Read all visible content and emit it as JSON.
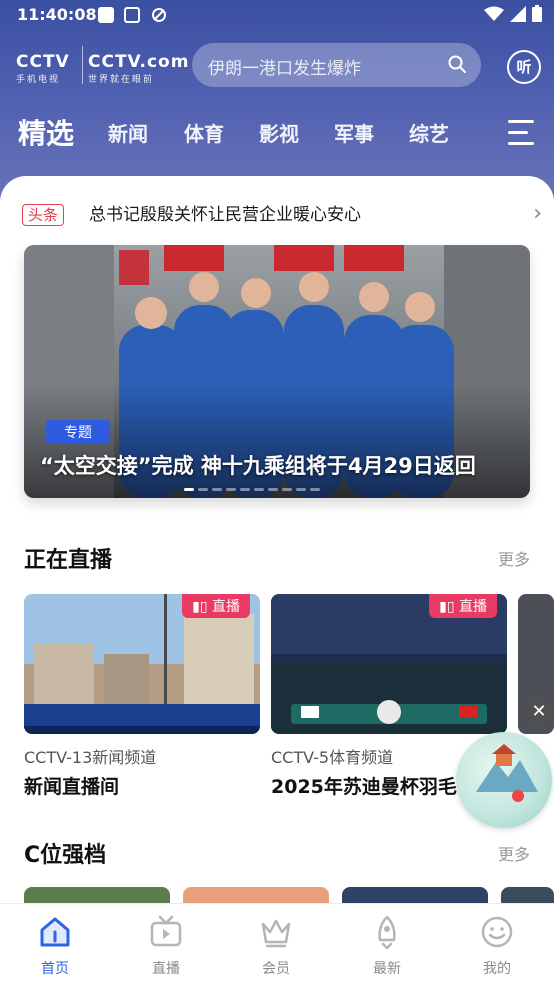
{
  "status_bar": {
    "time": "11:40:08"
  },
  "header": {
    "logo_text": "CCTV",
    "logo_sub": "手机电视",
    "logo_text2": "CCTV.com",
    "logo_sub2": "世界就在眼前",
    "search_placeholder": "伊朗一港口发生爆炸",
    "listen_label": "听"
  },
  "tabs": [
    "精选",
    "新闻",
    "体育",
    "影视",
    "军事",
    "综艺"
  ],
  "headline": {
    "tag": "头条",
    "text": "总书记殷殷关怀让民营企业暖心安心"
  },
  "banner": {
    "tag": "专题",
    "caption": "“太空交接”完成 神十九乘组将于4月29日返回"
  },
  "live": {
    "title": "正在直播",
    "more": "更多",
    "badge": "直播",
    "cards": [
      {
        "channel": "CCTV-13新闻频道",
        "name": "新闻直播间"
      },
      {
        "channel": "CCTV-5体育频道",
        "name": "2025年苏迪曼杯羽毛"
      }
    ]
  },
  "cpos": {
    "title": "C位强档",
    "more": "更多"
  },
  "bottom_nav": [
    {
      "label": "首页",
      "icon": "home-icon",
      "active": true
    },
    {
      "label": "直播",
      "icon": "tv-icon",
      "active": false
    },
    {
      "label": "会员",
      "icon": "crown-icon",
      "active": false
    },
    {
      "label": "最新",
      "icon": "rocket-icon",
      "active": false
    },
    {
      "label": "我的",
      "icon": "smile-face-icon",
      "active": false
    }
  ],
  "colors": {
    "header": "#3b4fa0",
    "accent": "#2d64e0",
    "live_badge": "#e83a63",
    "headline_tag": "#e5404f"
  }
}
